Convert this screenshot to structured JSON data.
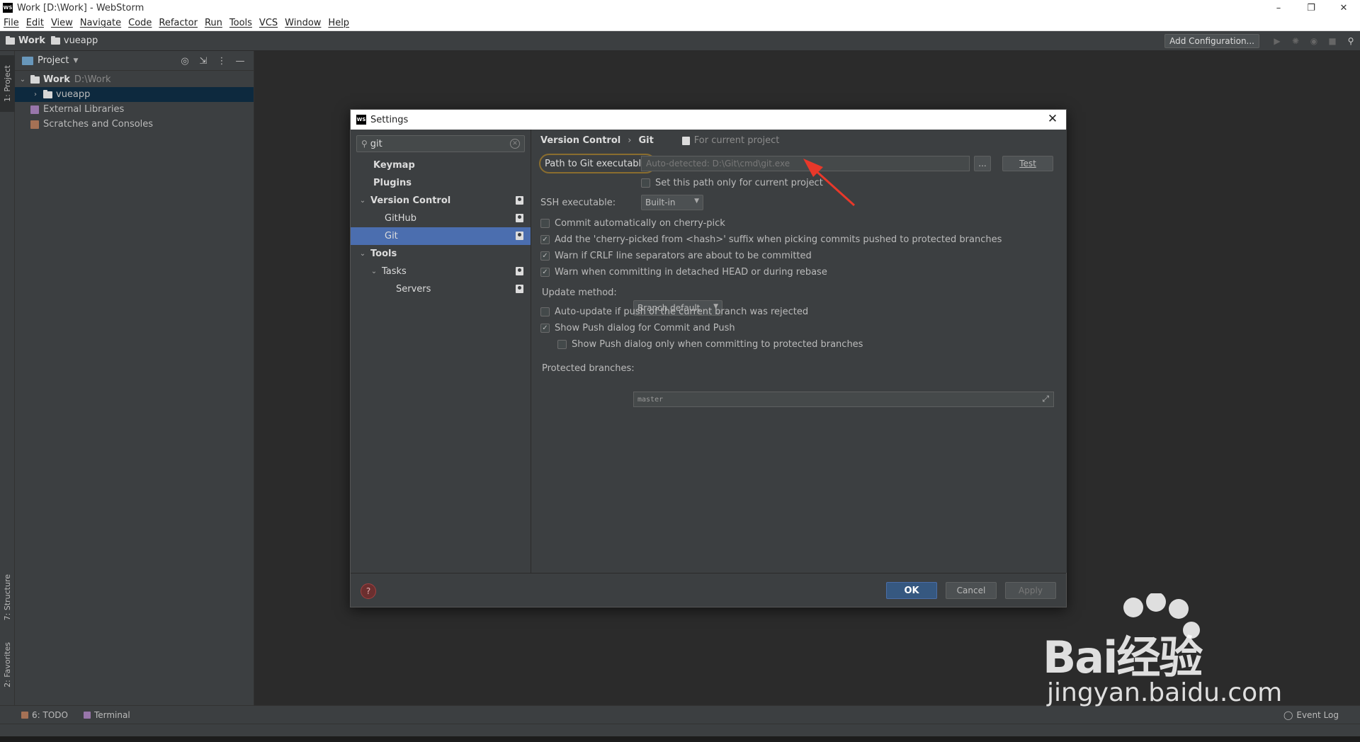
{
  "window": {
    "logo": "WS",
    "title": "Work [D:\\Work] - WebStorm",
    "controls": [
      "–",
      "❐",
      "✕"
    ]
  },
  "menu": [
    "File",
    "Edit",
    "View",
    "Navigate",
    "Code",
    "Refactor",
    "Run",
    "Tools",
    "VCS",
    "Window",
    "Help"
  ],
  "navbar": {
    "crumbs": [
      "Work",
      "vueapp"
    ],
    "add_config": "Add Configuration...",
    "icons": [
      "run-icon",
      "debug-icon",
      "coverage-icon",
      "stop-icon",
      "search-icon"
    ]
  },
  "left_strip": {
    "tabs": [
      "1: Project",
      "7: Structure",
      "2: Favorites"
    ]
  },
  "project_panel": {
    "title": "Project",
    "tools": [
      "◎",
      "⇲",
      "⋮",
      "—"
    ],
    "tree": {
      "root_name": "Work",
      "root_path": "D:\\Work",
      "child": "vueapp",
      "libs": "External Libraries",
      "scratches": "Scratches and Consoles"
    }
  },
  "bottom_tools": {
    "todo": "6: TODO",
    "terminal": "Terminal",
    "event_log": "Event Log"
  },
  "dialog": {
    "logo": "WS",
    "title": "Settings",
    "search_value": "git",
    "tree": [
      {
        "label": "Keymap",
        "bold": true,
        "level": 0
      },
      {
        "label": "Plugins",
        "bold": true,
        "level": 0
      },
      {
        "label": "Version Control",
        "bold": true,
        "level": 0,
        "expanded": true
      },
      {
        "label": "GitHub",
        "level": 1
      },
      {
        "label": "Git",
        "level": 1,
        "selected": true
      },
      {
        "label": "Tools",
        "bold": true,
        "level": 0,
        "expanded": true
      },
      {
        "label": "Tasks",
        "level": 1,
        "expanded": true
      },
      {
        "label": "Servers",
        "level": 2
      }
    ],
    "breadcrumb": {
      "parent": "Version Control",
      "sep": "›",
      "current": "Git",
      "scope": "For current project"
    },
    "git_path_label": "Path to Git executable:",
    "git_path_placeholder": "Auto-detected: D:\\Git\\cmd\\git.exe",
    "browse_label": "...",
    "test_label": "Test",
    "set_path_label": "Set this path only for current project",
    "ssh_label": "SSH executable:",
    "ssh_value": "Built-in",
    "options": [
      {
        "label": "Commit automatically on cherry-pick",
        "checked": false
      },
      {
        "label": "Add the 'cherry-picked from <hash>' suffix when picking commits pushed to protected branches",
        "checked": true
      },
      {
        "label": "Warn if CRLF line separators are about to be committed",
        "checked": true
      },
      {
        "label": "Warn when committing in detached HEAD or during rebase",
        "checked": true
      }
    ],
    "update_method_label": "Update method:",
    "update_method_value": "Branch default",
    "auto_update_label": "Auto-update if push of the current branch was rejected",
    "show_push_label": "Show Push dialog for Commit and Push",
    "show_push_protected_label": "Show Push dialog only when committing to protected branches",
    "protected_label": "Protected branches:",
    "protected_value": "master",
    "ok": "OK",
    "cancel": "Cancel",
    "apply": "Apply",
    "help": "?"
  },
  "watermark": {
    "brand": "Bai经验",
    "url": "jingyan.baidu.com"
  },
  "colors": {
    "selection": "#4b6eaf",
    "ok_button": "#365880",
    "annotation_arrow": "#e8382a"
  }
}
